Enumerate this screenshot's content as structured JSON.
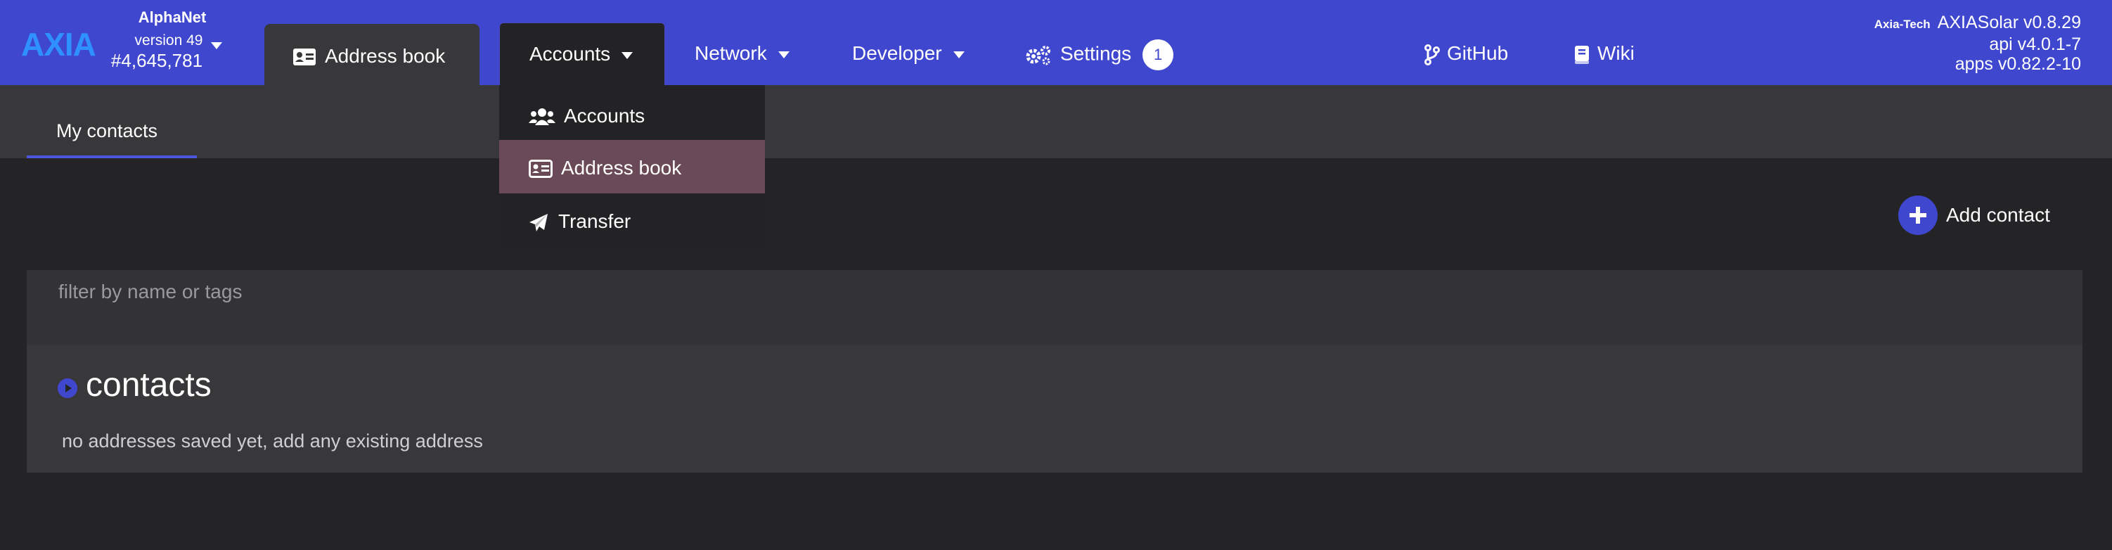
{
  "header": {
    "logo": "AXIA",
    "chain_name": "AlphaNet",
    "chain_version": "version 49",
    "block_number": "#4,645,781",
    "tabs": {
      "address_book": "Address book",
      "accounts": "Accounts"
    },
    "nav": {
      "network": "Network",
      "developer": "Developer",
      "settings": "Settings",
      "settings_badge": "1",
      "github": "GitHub",
      "wiki": "Wiki"
    },
    "info": {
      "brand": "Axia-Tech",
      "client": "AXIASolar v0.8.29",
      "api": "api v4.0.1-7",
      "apps": "apps v0.82.2-10"
    }
  },
  "subtabs": {
    "my_contacts": "My contacts"
  },
  "dropdown": {
    "items": [
      {
        "label": "Accounts",
        "icon": "users-icon"
      },
      {
        "label": "Address book",
        "icon": "address-card-icon",
        "active": true
      },
      {
        "label": "Transfer",
        "icon": "paper-plane-icon"
      }
    ]
  },
  "actions": {
    "add_contact": "Add contact"
  },
  "filter": {
    "placeholder": "filter by name or tags",
    "value": ""
  },
  "contacts": {
    "title": "contacts",
    "empty_message": "no addresses saved yet, add any existing address"
  },
  "colors": {
    "header_bg": "#3f47cf",
    "accent": "#4d56dc",
    "active_item": "#6a4a57",
    "page_bg": "#242426"
  }
}
